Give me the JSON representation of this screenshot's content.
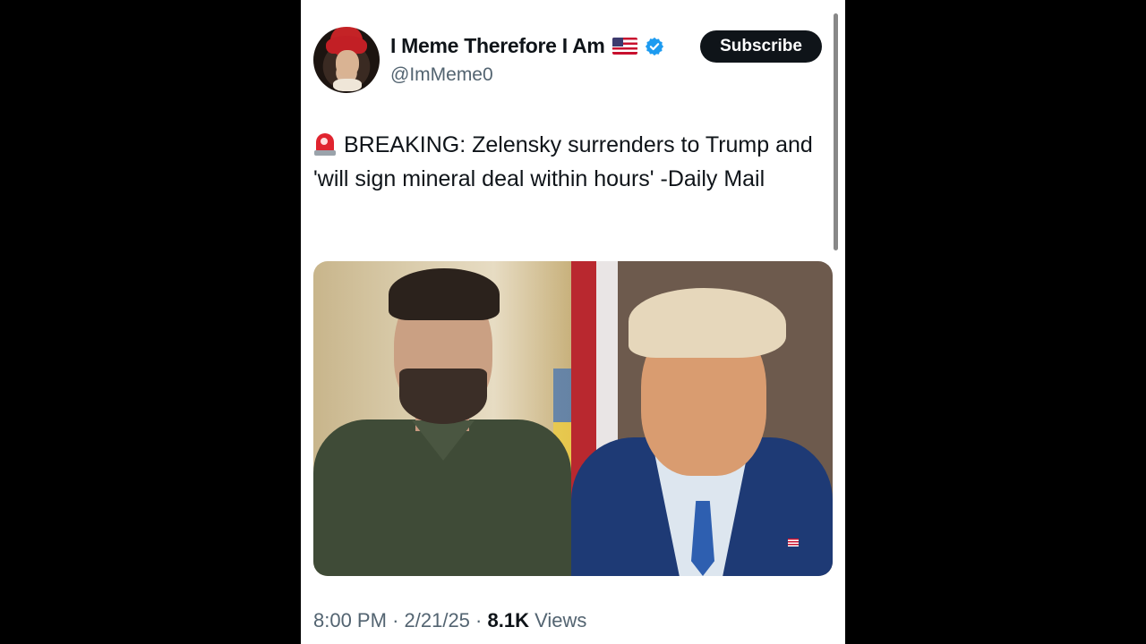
{
  "tweet": {
    "author_name": "I Meme Therefore I Am",
    "author_handle": "@ImMeme0",
    "flag_emoji": "us-flag",
    "verified": true,
    "subscribe_label": "Subscribe",
    "siren_icon": "police-siren-icon",
    "text": "BREAKING: Zelensky surrenders to Trump and 'will sign mineral deal within hours' -Daily Mail",
    "time": "8:00 PM",
    "date": "2/21/25",
    "views_count": "8.1K",
    "views_label": "Views",
    "separator": "·"
  },
  "colors": {
    "background": "#000000",
    "card": "#ffffff",
    "text_primary": "#0f1419",
    "text_secondary": "#536471",
    "verified_blue": "#1d9bf0",
    "subscribe_bg": "#0f1419"
  }
}
